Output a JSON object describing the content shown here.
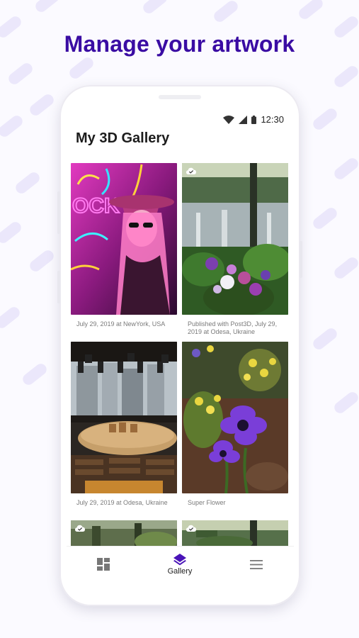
{
  "headline": "Manage your artwork",
  "status_bar": {
    "time": "12:30",
    "icons": [
      "wifi-icon",
      "signal-icon",
      "battery-icon"
    ]
  },
  "app": {
    "title": "My 3D Gallery"
  },
  "gallery": {
    "items": [
      {
        "caption": "July 29, 2019 at NewYork, USA",
        "cloud": false
      },
      {
        "caption": "Published with Post3D, July 29, 2019 at Odesa, Ukraine",
        "cloud": true
      },
      {
        "caption": "July 29, 2019 at Odesa, Ukraine",
        "cloud": false
      },
      {
        "caption": "Super Flower",
        "cloud": false
      },
      {
        "caption": "",
        "cloud": true
      },
      {
        "caption": "",
        "cloud": true
      }
    ]
  },
  "bottom_nav": {
    "items": [
      {
        "label": "",
        "icon": "dashboard-icon",
        "active": false
      },
      {
        "label": "Gallery",
        "icon": "layers-icon",
        "active": true
      },
      {
        "label": "",
        "icon": "menu-icon",
        "active": false
      }
    ]
  },
  "colors": {
    "accent": "#3a0ca3",
    "active_nav": "#4a14b8"
  }
}
